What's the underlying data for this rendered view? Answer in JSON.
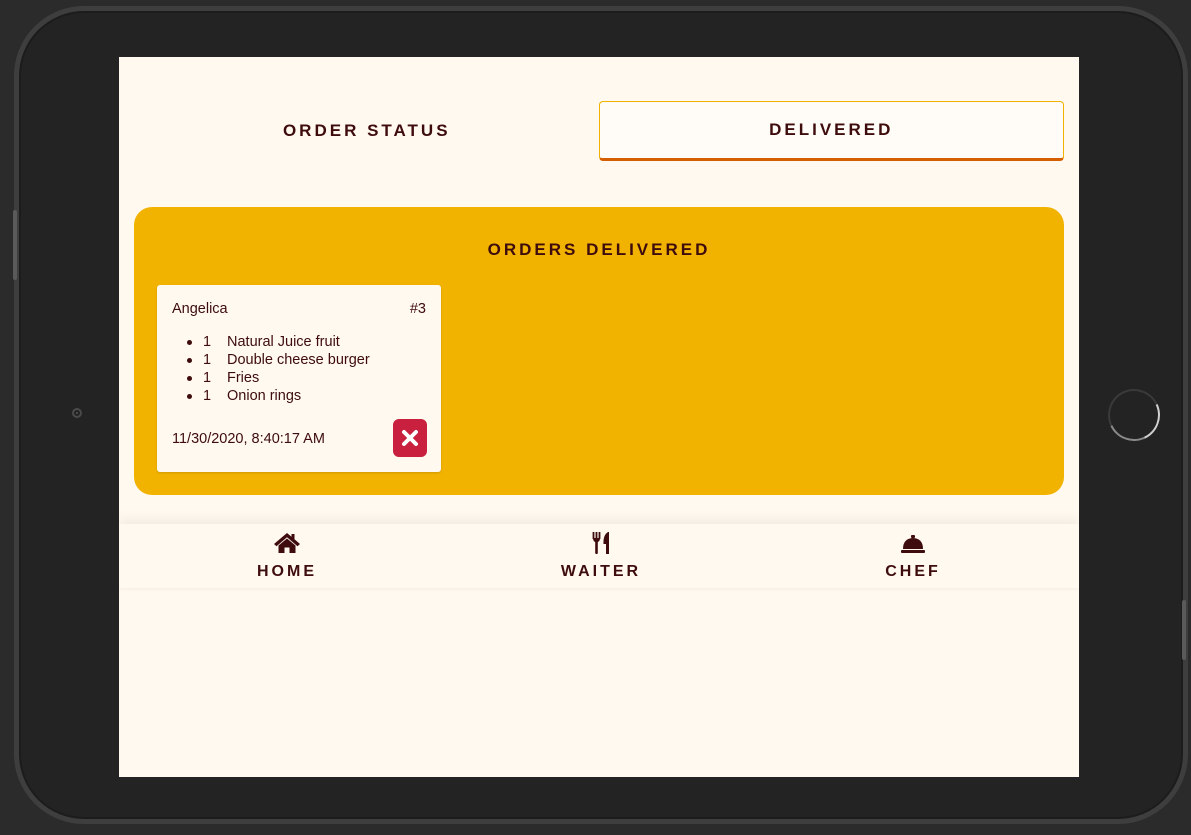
{
  "tabs": {
    "order_status": "ORDER STATUS",
    "delivered": "DELIVERED"
  },
  "panel": {
    "title": "ORDERS DELIVERED"
  },
  "order": {
    "customer": "Angelica",
    "number": "#3",
    "items": [
      {
        "qty": "1",
        "name": "Natural Juice fruit"
      },
      {
        "qty": "1",
        "name": "Double cheese burger"
      },
      {
        "qty": "1",
        "name": "Fries"
      },
      {
        "qty": "1",
        "name": "Onion rings"
      }
    ],
    "timestamp": "11/30/2020, 8:40:17 AM"
  },
  "nav": {
    "home": "HOME",
    "waiter": "WAITER",
    "chef": "CHEF"
  },
  "icons": {
    "home": "home-icon",
    "waiter": "utensils-icon",
    "chef": "service-bell-icon",
    "delete": "close-icon"
  },
  "colors": {
    "background": "#fff9f0",
    "accent": "#f2b300",
    "text": "#3e0c0c",
    "tab_underline": "#d55e00",
    "delete": "#c8203e"
  }
}
